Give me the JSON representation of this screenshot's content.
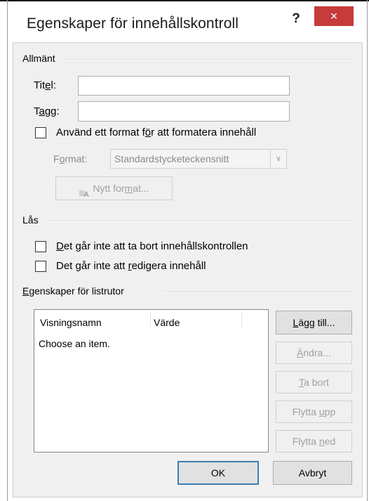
{
  "dialog": {
    "title": "Egenskaper för innehållskontroll",
    "help_label": "?",
    "close_label": "×"
  },
  "general": {
    "group_title": "Allmänt",
    "title_label_pre": "Tit",
    "title_label_u": "e",
    "title_label_post": "l:",
    "title_value": "",
    "tag_label_pre": "T",
    "tag_label_u": "a",
    "tag_label_post": "gg:",
    "tag_value": "",
    "use_format_pre": "Använd ett format f",
    "use_format_u": "ö",
    "use_format_post": "r att formatera innehåll",
    "use_format_checked": false,
    "format_label_pre": "F",
    "format_label_u": "o",
    "format_label_post": "rmat:",
    "format_value": "Standardstycketeckensnitt",
    "new_format_pre": "Nytt for",
    "new_format_u": "m",
    "new_format_post": "at..."
  },
  "lock": {
    "group_title": "Lås",
    "no_delete_pre": "",
    "no_delete_u": "D",
    "no_delete_post": "et går inte att ta bort innehållskontrollen",
    "no_delete_checked": false,
    "no_edit_pre": "Det går inte att ",
    "no_edit_u": "r",
    "no_edit_post": "edigera innehåll",
    "no_edit_checked": false
  },
  "listbox": {
    "group_title_pre": "",
    "group_title_u": "E",
    "group_title_post": "genskaper för listrutor",
    "columns": [
      "Visningsnamn",
      "Värde"
    ],
    "rows": [
      {
        "name": "Choose an item.",
        "value": ""
      }
    ],
    "add_pre": "",
    "add_u": "L",
    "add_post": "ägg till...",
    "modify_pre": "",
    "modify_u": "Ä",
    "modify_post": "ndra...",
    "remove_pre": "",
    "remove_u": "T",
    "remove_post": "a bort",
    "move_up_pre": "Flytta ",
    "move_up_u": "u",
    "move_up_post": "pp",
    "move_down_pre": "Flytta ",
    "move_down_u": "n",
    "move_down_post": "ed"
  },
  "footer": {
    "ok_label": "OK",
    "cancel_label": "Avbryt"
  },
  "colors": {
    "close_button": "#c73b3b",
    "dialog_face": "#f0f0f0",
    "default_button_border": "#3c7fb1",
    "disabled_text": "#a0a0a0"
  }
}
